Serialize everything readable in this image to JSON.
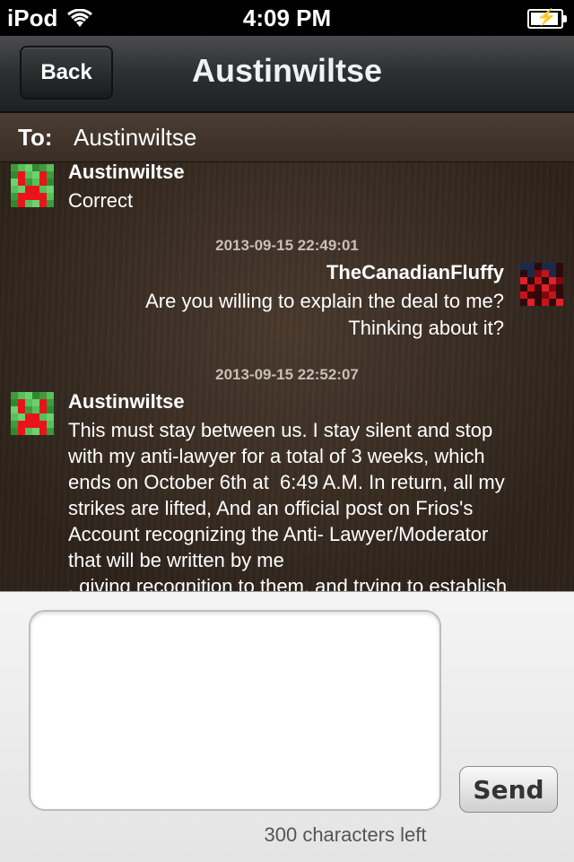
{
  "status_bar": {
    "carrier": "iPod",
    "time": "4:09 PM"
  },
  "nav": {
    "back_label": "Back",
    "title": "Austinwiltse"
  },
  "to_bar": {
    "label": "To:",
    "value": "Austinwiltse"
  },
  "messages": [
    {
      "sender": "Austinwiltse",
      "text": "Correct",
      "side": "left",
      "avatar": "creeper-avatar"
    },
    {
      "timestamp": "2013-09-15 22:49:01",
      "sender": "TheCanadianFluffy",
      "lines": [
        "Are you willing to explain the deal to me?",
        "Thinking about it?"
      ],
      "side": "right",
      "avatar": "dark-pixel-avatar"
    },
    {
      "timestamp": "2013-09-15 22:52:07",
      "sender": "Austinwiltse",
      "lines": [
        "This must stay between us. I stay silent and stop",
        "with my anti-lawyer for a total of 3 weeks, which",
        "ends on October 6th at  6:49 A.M. In return, all my",
        "strikes are lifted, And an official post on Frios's",
        "Account recognizing the Anti- Lawyer/Moderator",
        "that will be written by me",
        ", giving recognition to them, and trying to establish"
      ],
      "side": "left",
      "avatar": "creeper-avatar"
    }
  ],
  "compose": {
    "placeholder": "",
    "send_label": "Send",
    "chars_left": "300 characters left"
  },
  "colors": {
    "nav_bg": "#2c2e30",
    "to_bar_bg": "#3a2e25",
    "conversation_bg": "#3a2d23",
    "compose_bg": "#ececec",
    "creeper_green": "#4caf50",
    "creeper_red": "#e8141a"
  }
}
